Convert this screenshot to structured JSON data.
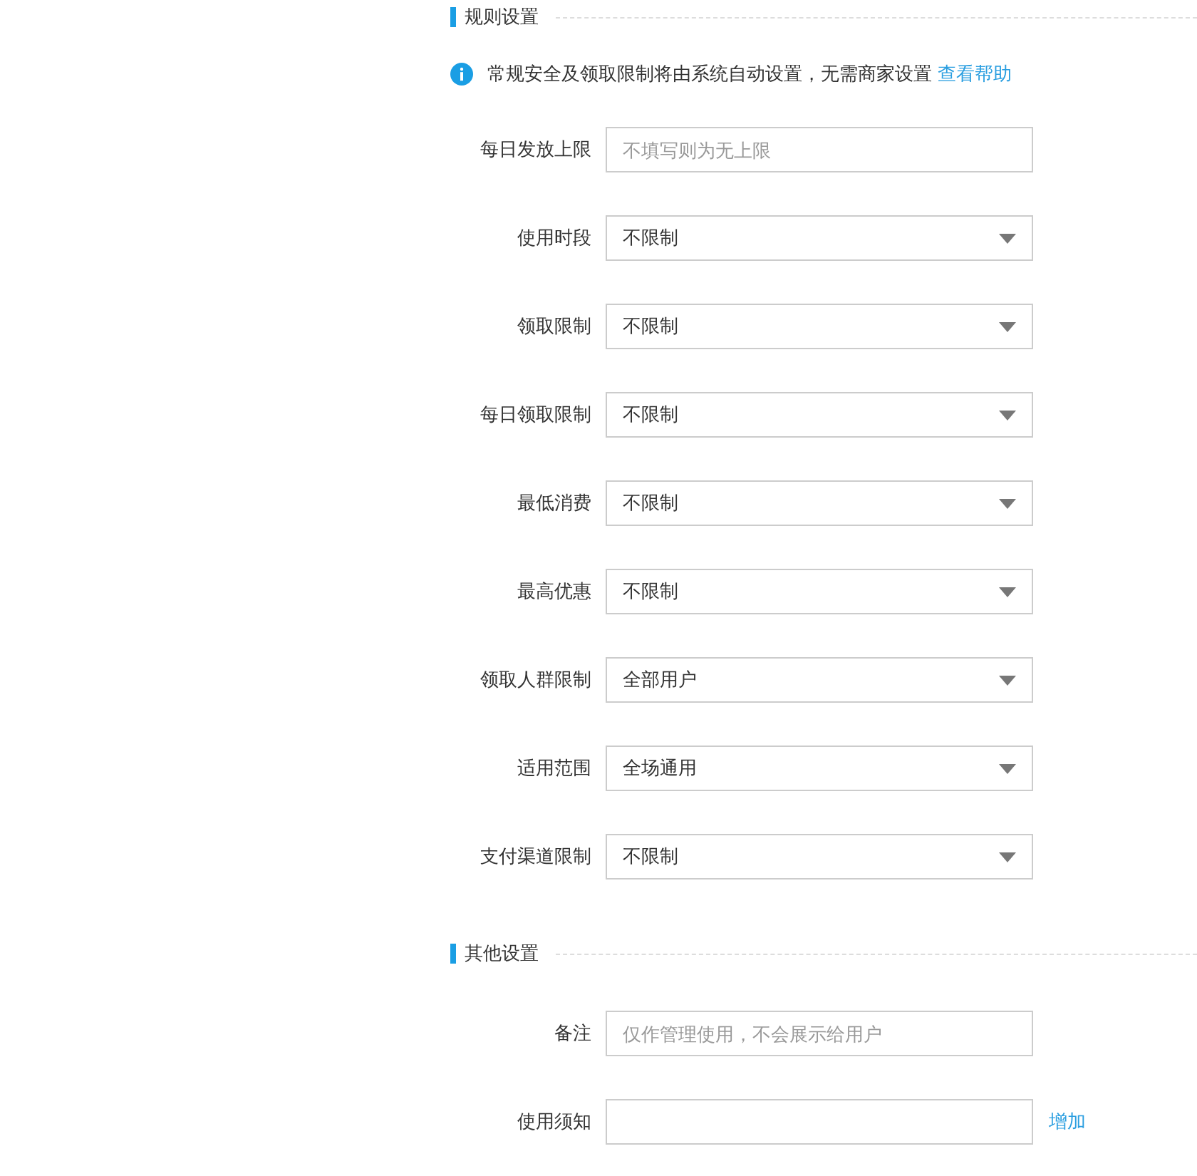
{
  "sections": [
    {
      "title": "规则设置",
      "notice": {
        "text": "常规安全及领取限制将由系统自动设置，无需商家设置",
        "link": "查看帮助"
      },
      "groups": [
        [
          {
            "kind": "input",
            "label": "每日发放上限",
            "placeholder": "不填写则为无上限"
          },
          {
            "kind": "select",
            "label": "使用时段",
            "value": "不限制"
          }
        ],
        [
          {
            "kind": "select",
            "label": "领取限制",
            "value": "不限制"
          },
          {
            "kind": "select",
            "label": "每日领取限制",
            "value": "不限制"
          },
          {
            "kind": "select",
            "label": "最低消费",
            "value": "不限制"
          },
          {
            "kind": "select",
            "label": "最高优惠",
            "value": "不限制"
          },
          {
            "kind": "select",
            "label": "领取人群限制",
            "value": "全部用户"
          },
          {
            "kind": "select",
            "label": "适用范围",
            "value": "全场通用"
          },
          {
            "kind": "select",
            "label": "支付渠道限制",
            "value": "不限制"
          }
        ]
      ]
    },
    {
      "title": "其他设置",
      "groups": [
        [
          {
            "kind": "input",
            "label": "备注",
            "placeholder": "仅作管理使用，不会展示给用户"
          },
          {
            "kind": "input",
            "label": "使用须知",
            "action": "增加"
          }
        ]
      ]
    }
  ]
}
